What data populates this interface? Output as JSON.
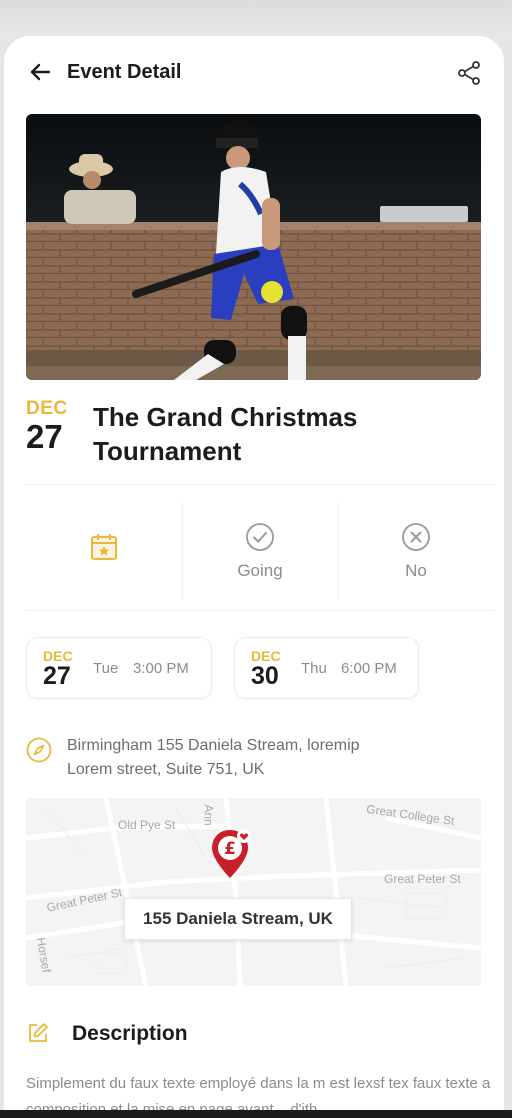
{
  "header": {
    "title": "Event Detail",
    "back_icon": "arrow-left-icon",
    "share_icon": "share-icon"
  },
  "event": {
    "month": "DEC",
    "day": "27",
    "title_line1": "The Grand Christmas",
    "title_line2": "Tournament"
  },
  "rsvp": {
    "options": [
      {
        "label": "",
        "icon": "calendar-star-icon"
      },
      {
        "label": "Going",
        "icon": "check-circle-icon"
      },
      {
        "label": "No",
        "icon": "x-circle-icon"
      }
    ]
  },
  "dates": [
    {
      "month": "DEC",
      "day": "27",
      "weekday": "Tue",
      "time": "3:00 PM"
    },
    {
      "month": "DEC",
      "day": "30",
      "weekday": "Thu",
      "time": "6:00 PM"
    }
  ],
  "address": {
    "line1": "Birmingham 155 Daniela Stream, loremip",
    "line2": "Lorem street, Suite 751, UK"
  },
  "map": {
    "callout": "155 Daniela Stream, UK",
    "labels": {
      "old_pye": "Old Pye St",
      "great_college": "Great College St",
      "great_peter_left": "Great Peter St",
      "great_peter_right": "Great Peter St",
      "ann": "Ann",
      "horse": "Horsef"
    }
  },
  "description": {
    "title": "Description",
    "text": "Simplement du faux texte employé dans la m est lexsf tex faux texte a composition et la mise en page avant... d'ith"
  },
  "colors": {
    "accent": "#e8b93a",
    "pin": "#c8202a",
    "text": "#1c1c1c",
    "muted": "#8c8c8c"
  }
}
